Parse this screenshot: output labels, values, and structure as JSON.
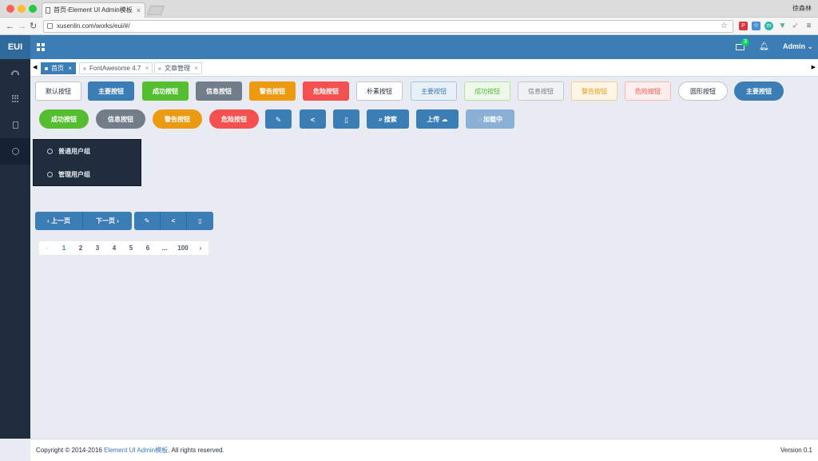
{
  "browser": {
    "tab_title": "首页-Element UI Admin模板",
    "user": "徐森林",
    "url": "xusenlin.com/works/eui/#/"
  },
  "header": {
    "logo": "EUI",
    "mail_count": "3",
    "user_label": "Admin"
  },
  "tabs": [
    {
      "label": "首页",
      "active": true
    },
    {
      "label": "FontAwesome 4.7",
      "active": false
    },
    {
      "label": "文章管理",
      "active": false
    }
  ],
  "buttons_row1": [
    {
      "label": "默认按钮",
      "style": "default"
    },
    {
      "label": "主要按钮",
      "style": "primary"
    },
    {
      "label": "成功按钮",
      "style": "success"
    },
    {
      "label": "信息按钮",
      "style": "info"
    },
    {
      "label": "警告按钮",
      "style": "warning"
    },
    {
      "label": "危险按钮",
      "style": "danger"
    },
    {
      "label": "朴素按钮",
      "style": "plain"
    },
    {
      "label": "主要按钮",
      "style": "plain-primary"
    },
    {
      "label": "成功按钮",
      "style": "plain-success"
    },
    {
      "label": "信息按钮",
      "style": "plain-info"
    },
    {
      "label": "警告按钮",
      "style": "plain-warning"
    },
    {
      "label": "危险按钮",
      "style": "plain-danger"
    },
    {
      "label": "圆形按钮",
      "style": "round-default"
    },
    {
      "label": "主要按钮",
      "style": "round-primary"
    }
  ],
  "buttons_row2": [
    {
      "label": "成功按钮",
      "style": "round-success"
    },
    {
      "label": "信息按钮",
      "style": "round-info"
    },
    {
      "label": "警告按钮",
      "style": "round-warning"
    },
    {
      "label": "危险按钮",
      "style": "round-danger"
    }
  ],
  "icon_buttons": {
    "edit_icon": "✎",
    "share_icon": "⋖",
    "delete_icon": "🗑",
    "search_label": "搜索",
    "upload_label": "上传",
    "loading_label": "加载中"
  },
  "dropdown": {
    "items": [
      "普通用户组",
      "管理用户组"
    ]
  },
  "button_group": {
    "prev_label": "上一页",
    "next_label": "下一页"
  },
  "pagination": {
    "pages": [
      "1",
      "2",
      "3",
      "4",
      "5",
      "6",
      "...",
      "100"
    ],
    "current": "1"
  },
  "footer": {
    "copyright": "Copyright © 2014-2016 ",
    "brand": "Element UI Admin模板",
    "rights": ". All rights reserved.",
    "version": "Version 0.1"
  },
  "colors": {
    "primary": "#3b7db5",
    "success": "#55be30",
    "info": "#727d8a",
    "warning": "#ec9a11",
    "danger": "#f55050",
    "sidebar": "#1f2d3d"
  }
}
